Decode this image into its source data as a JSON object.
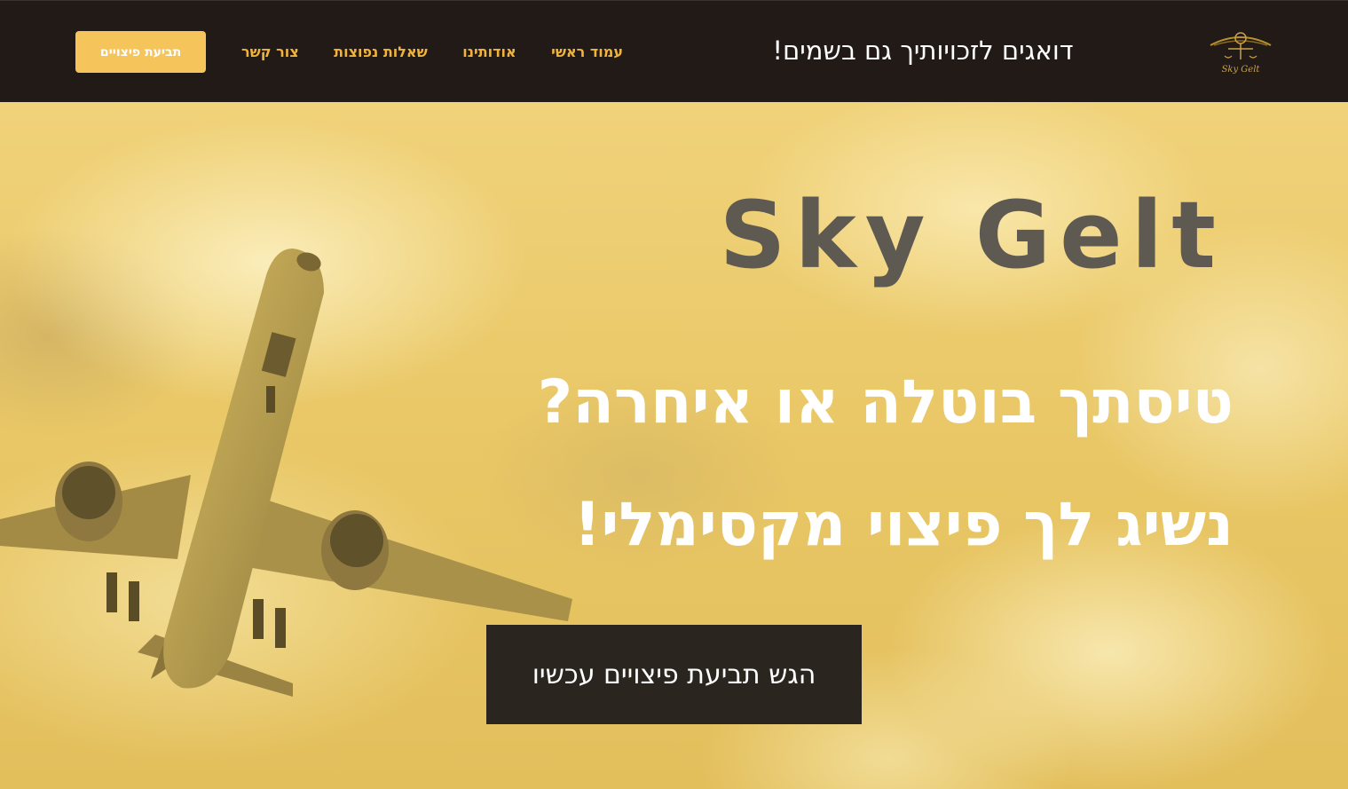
{
  "header": {
    "logo_text": "Sky Gelt",
    "tagline": "דואגים לזכויותיך גם בשמים!",
    "nav": [
      {
        "label": "עמוד ראשי"
      },
      {
        "label": "אודותינו"
      },
      {
        "label": "שאלות נפוצות"
      },
      {
        "label": "צור קשר"
      }
    ],
    "cta_label": "תביעת פיצויים"
  },
  "hero": {
    "brand": "Sky Gelt",
    "headline_line1": "טיסתך בוטלה או איחרה?",
    "headline_line2": "נשיג לך פיצוי מקסימלי!",
    "cta_label": "הגש תביעת פיצויים עכשיו"
  },
  "colors": {
    "header_bg": "#211a16",
    "accent": "#f2b33a",
    "cta_bg": "#f5c45a",
    "hero_cta_bg": "#2b2520",
    "brand_text": "#5e5a52"
  },
  "icons": [
    "plane-illustration",
    "scales-logo-icon"
  ]
}
